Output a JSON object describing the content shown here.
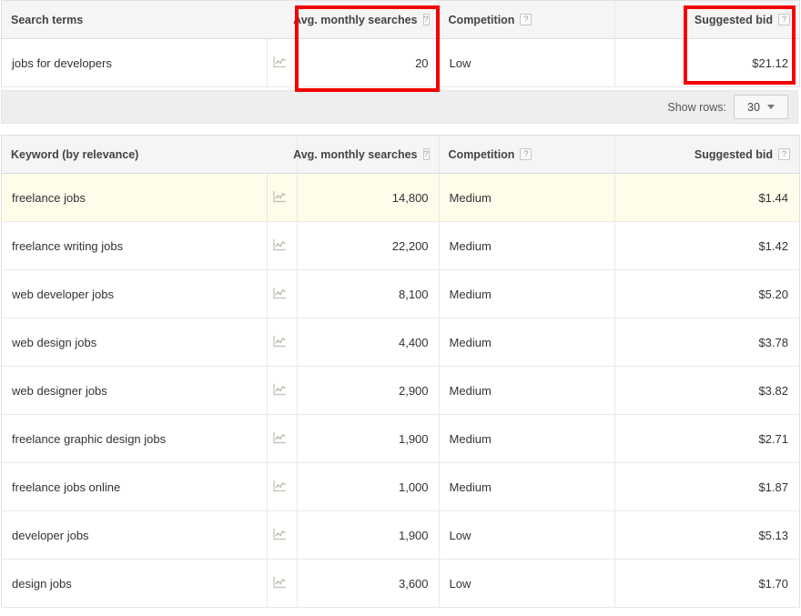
{
  "icons": {
    "help": "?",
    "sparkline": "sparkline-chart-icon",
    "caret": "chevron-down-icon"
  },
  "colors": {
    "annotation_red": "#f40000",
    "row_highlight": "#fdfdea",
    "header_bg": "#f5f5f5",
    "toolbar_bg": "#eeeeee",
    "border": "#e8e8e8"
  },
  "search_terms_table": {
    "columns": [
      {
        "label": "Search terms",
        "align": "left",
        "help": false
      },
      {
        "label": "",
        "align": "left",
        "help": false
      },
      {
        "label": "Avg. monthly searches",
        "align": "right",
        "help": true
      },
      {
        "label": "Competition",
        "align": "left",
        "help": true
      },
      {
        "label": "Suggested bid",
        "align": "right",
        "help": true
      }
    ],
    "rows": [
      {
        "keyword": "jobs for developers",
        "avg_monthly_searches": "20",
        "competition": "Low",
        "suggested_bid": "$21.12",
        "highlight": false
      }
    ]
  },
  "toolbar": {
    "show_rows_label": "Show rows:",
    "show_rows_value": "30"
  },
  "keyword_ideas_table": {
    "columns": [
      {
        "label": "Keyword (by relevance)",
        "align": "left",
        "help": false
      },
      {
        "label": "",
        "align": "left",
        "help": false
      },
      {
        "label": "Avg. monthly searches",
        "align": "right",
        "help": true
      },
      {
        "label": "Competition",
        "align": "left",
        "help": true
      },
      {
        "label": "Suggested bid",
        "align": "right",
        "help": true
      }
    ],
    "rows": [
      {
        "keyword": "freelance jobs",
        "avg_monthly_searches": "14,800",
        "competition": "Medium",
        "suggested_bid": "$1.44",
        "highlight": true
      },
      {
        "keyword": "freelance writing jobs",
        "avg_monthly_searches": "22,200",
        "competition": "Medium",
        "suggested_bid": "$1.42",
        "highlight": false
      },
      {
        "keyword": "web developer jobs",
        "avg_monthly_searches": "8,100",
        "competition": "Medium",
        "suggested_bid": "$5.20",
        "highlight": false
      },
      {
        "keyword": "web design jobs",
        "avg_monthly_searches": "4,400",
        "competition": "Medium",
        "suggested_bid": "$3.78",
        "highlight": false
      },
      {
        "keyword": "web designer jobs",
        "avg_monthly_searches": "2,900",
        "competition": "Medium",
        "suggested_bid": "$3.82",
        "highlight": false
      },
      {
        "keyword": "freelance graphic design jobs",
        "avg_monthly_searches": "1,900",
        "competition": "Medium",
        "suggested_bid": "$2.71",
        "highlight": false
      },
      {
        "keyword": "freelance jobs online",
        "avg_monthly_searches": "1,000",
        "competition": "Medium",
        "suggested_bid": "$1.87",
        "highlight": false
      },
      {
        "keyword": "developer jobs",
        "avg_monthly_searches": "1,900",
        "competition": "Low",
        "suggested_bid": "$5.13",
        "highlight": false
      },
      {
        "keyword": "design jobs",
        "avg_monthly_searches": "3,600",
        "competition": "Low",
        "suggested_bid": "$1.70",
        "highlight": false
      }
    ]
  },
  "annotations": [
    {
      "name": "avg-monthly-searches-column-highlight"
    },
    {
      "name": "suggested-bid-column-highlight"
    }
  ]
}
